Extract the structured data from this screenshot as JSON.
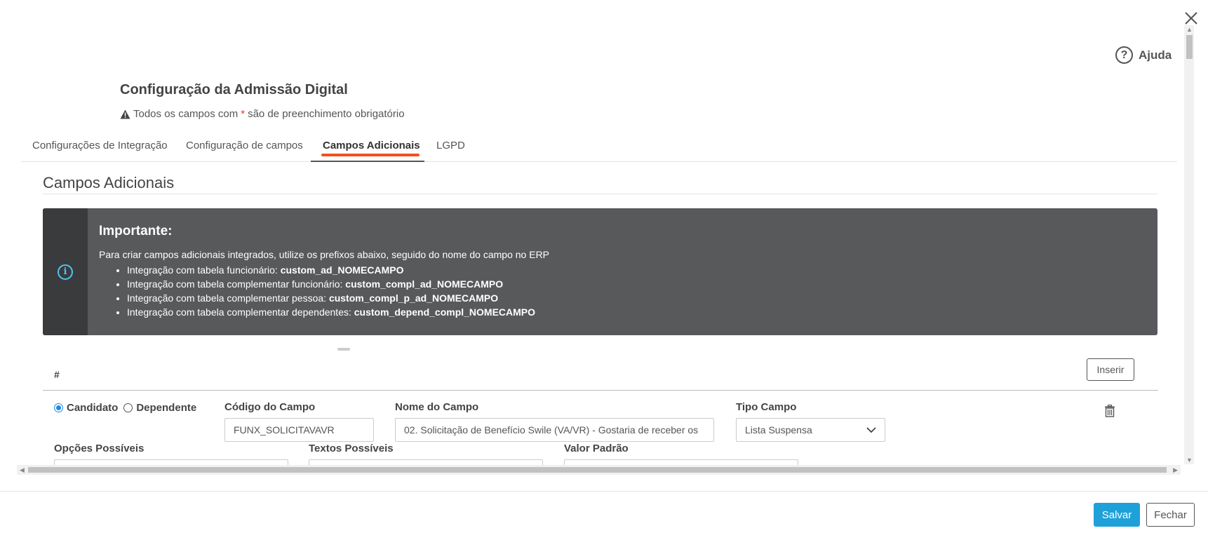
{
  "help": {
    "label": "Ajuda"
  },
  "page": {
    "title": "Configuração da Admissão Digital",
    "required_note_prefix": "Todos os campos com",
    "required_note_star": "*",
    "required_note_suffix": "são de preenchimento obrigatório"
  },
  "tabs": [
    {
      "label": "Configurações de Integração"
    },
    {
      "label": "Configuração de campos"
    },
    {
      "label": "Campos Adicionais",
      "active": true
    },
    {
      "label": "LGPD"
    }
  ],
  "section": {
    "title": "Campos Adicionais"
  },
  "alert": {
    "title": "Importante:",
    "text": "Para criar campos adicionais integrados, utilize os prefixos abaixo, seguido do nome do campo no ERP",
    "items": [
      {
        "text": "Integração com tabela funcionário: ",
        "bold": "custom_ad_NOMECAMPO"
      },
      {
        "text": "Integração com tabela complementar funcionário: ",
        "bold": "custom_compl_ad_NOMECAMPO"
      },
      {
        "text": "Integração com tabela complementar pessoa: ",
        "bold": "custom_compl_p_ad_NOMECAMPO"
      },
      {
        "text": "Integração com tabela complementar dependentes: ",
        "bold": "custom_depend_compl_NOMECAMPO"
      }
    ]
  },
  "table": {
    "header_hash": "#",
    "insert_label": "Inserir"
  },
  "row": {
    "radio_candidato": "Candidato",
    "radio_dependente": "Dependente",
    "selected": "Candidato",
    "codigo_label": "Código do Campo",
    "codigo_value": "FUNX_SOLICITAVAVR",
    "nome_label": "Nome do Campo",
    "nome_value": "02. Solicitação de Benefício Swile (VA/VR) - Gostaria de receber os",
    "tipo_label": "Tipo Campo",
    "tipo_value": "Lista Suspensa",
    "opcoes_label": "Opções Possíveis",
    "textos_label": "Textos Possíveis",
    "valor_label": "Valor Padrão"
  },
  "footer": {
    "save_label": "Salvar",
    "close_label": "Fechar"
  },
  "colors": {
    "accent": "#1ea1d8",
    "tab_underline": "#f4511e",
    "alert_bg": "#58595b",
    "info_icon": "#4fc3f7"
  }
}
